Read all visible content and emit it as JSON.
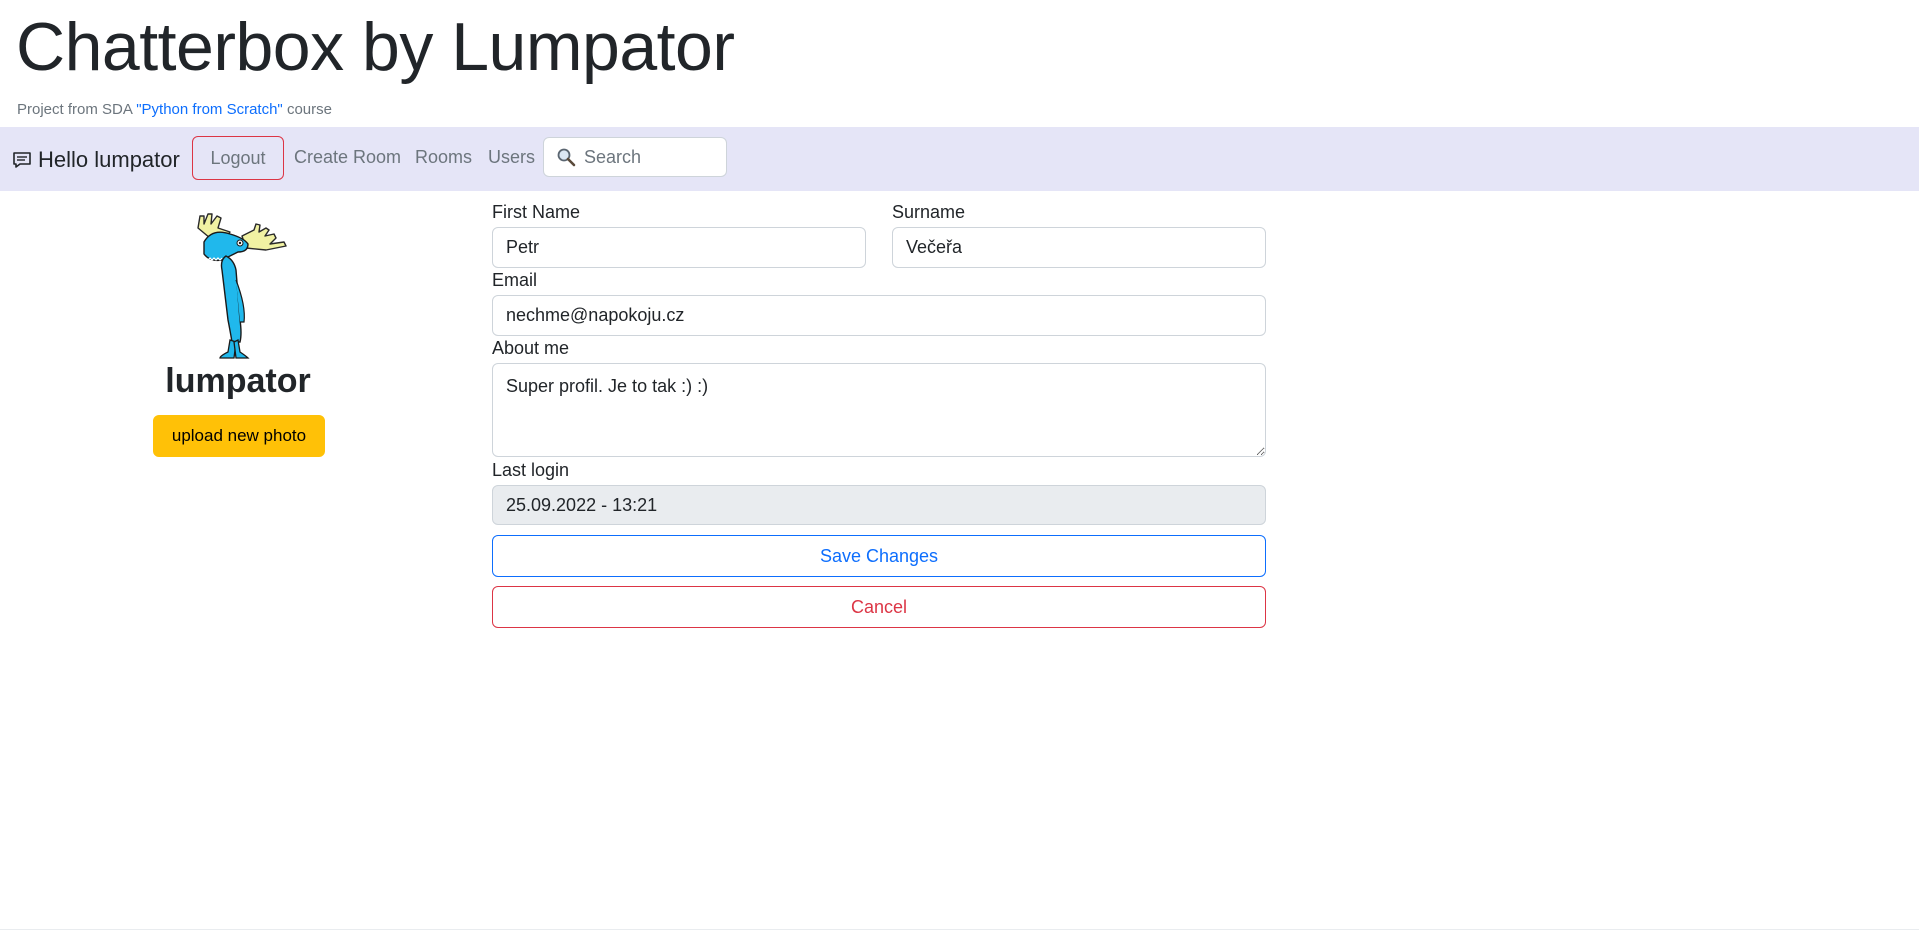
{
  "header": {
    "title": "Chatterbox by Lumpator",
    "subtitle_prefix": "Project from SDA",
    "subtitle_link": "\"Python from Scratch\"",
    "subtitle_suffix": "course"
  },
  "navbar": {
    "brand_icon": "chat-icon",
    "greeting": "Hello lumpator",
    "logout_label": "Logout",
    "links": [
      "Create Room",
      "Rooms",
      "Users"
    ],
    "search_icon": "magnifier-icon",
    "search_placeholder": "Search"
  },
  "profile": {
    "avatar": "moose-avatar",
    "username": "lumpator",
    "upload_label": "upload new photo"
  },
  "form": {
    "first_name_label": "First Name",
    "first_name_value": "Petr",
    "surname_label": "Surname",
    "surname_value": "Večeřa",
    "email_label": "Email",
    "email_value": "nechme@napokoju.cz",
    "about_label": "About me",
    "about_value": "Super profil. Je to tak :) :)",
    "last_login_label": "Last login",
    "last_login_value": "25.09.2022 - 13:21",
    "save_label": "Save Changes",
    "cancel_label": "Cancel"
  },
  "colors": {
    "navbar_bg": "#e5e5f7",
    "primary": "#0d6efd",
    "danger": "#dc3545",
    "warning": "#ffc107"
  }
}
